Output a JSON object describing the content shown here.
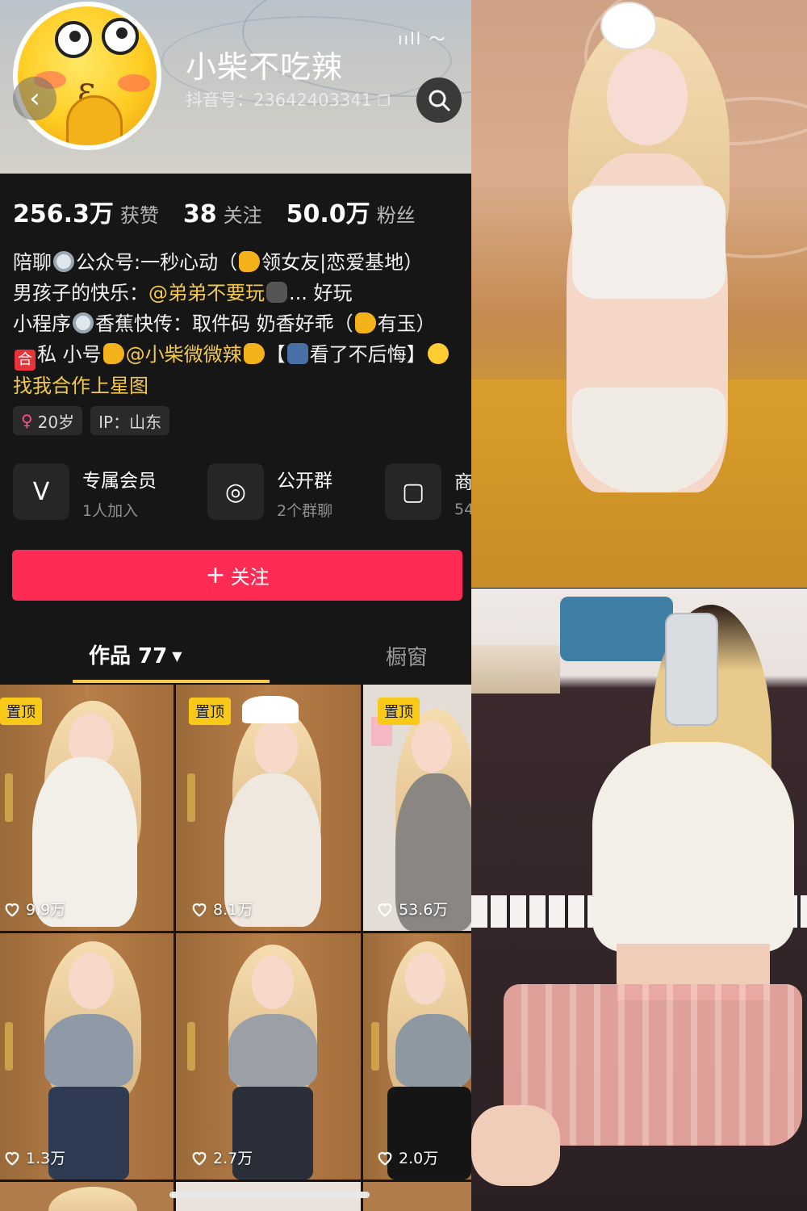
{
  "profile": {
    "name": "小柴不吃辣",
    "douyin_id": "抖音号：23642403341",
    "status_icons": "ııll 〜"
  },
  "stats": [
    {
      "value": "256.3万",
      "label": "获赞"
    },
    {
      "value": "38",
      "label": "关注"
    },
    {
      "value": "50.0万",
      "label": "粉丝"
    }
  ],
  "bio": {
    "line1_a": "陪聊",
    "line1_b": "公众号:一秒心动（",
    "line1_c": "领女友|恋爱基地）",
    "line2_a": "男孩子的快乐：",
    "line2_link": "@弟弟不要玩",
    "line2_b": "... 好玩",
    "line3_a": "小程序",
    "line3_b": "香蕉快传：取件码 奶香好乖（",
    "line3_c": "有玉）",
    "line4_red": "合",
    "line4_a": "私  小号",
    "line4_link": "@小柴微微辣",
    "line4_b": "【",
    "line4_c": "看了不后悔】",
    "cooperate": "找我合作上星图"
  },
  "tags": {
    "age": "20岁",
    "gender_symbol": "♀",
    "ip": "IP：山东"
  },
  "features": [
    {
      "title": "专属会员",
      "sub": "1人加入",
      "icon": "vip-v-icon",
      "glyph": "V"
    },
    {
      "title": "公开群",
      "sub": "2个群聊",
      "icon": "group-chat-icon",
      "glyph": "◎"
    },
    {
      "title": "商",
      "sub": "54",
      "icon": "shop-bag-icon",
      "glyph": "▢"
    }
  ],
  "follow_button": {
    "plus": "+",
    "label": "关注",
    "color": "#fe2c55"
  },
  "tabs": {
    "works": "作品 77",
    "works_arrow": "▼",
    "window": "橱窗"
  },
  "videos": [
    {
      "pinned": "置顶",
      "likes": "9.9万"
    },
    {
      "pinned": "置顶",
      "likes": "8.1万"
    },
    {
      "pinned": "置顶",
      "likes": "53.6万"
    },
    {
      "pinned": "",
      "likes": "1.3万"
    },
    {
      "pinned": "",
      "likes": "2.7万"
    },
    {
      "pinned": "",
      "likes": "2.0万"
    }
  ],
  "colors": {
    "accent_yellow": "#f2c94c",
    "pin_yellow": "#f9c91a",
    "background": "#161616"
  }
}
